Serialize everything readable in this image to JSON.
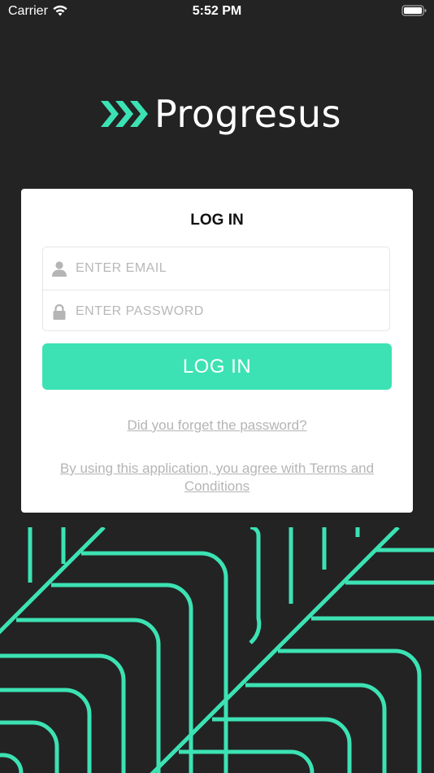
{
  "status_bar": {
    "carrier": "Carrier",
    "time": "5:52 PM"
  },
  "logo": {
    "name": "Progresus",
    "icon": "chevrons-right-icon",
    "accent_color": "#3ce2b3"
  },
  "login_card": {
    "title": "LOG IN",
    "email_placeholder": "ENTER EMAIL",
    "password_placeholder": "ENTER PASSWORD",
    "email_icon": "user-icon",
    "password_icon": "lock-icon",
    "login_button": "LOG IN",
    "forgot_password": "Did you forget the password?",
    "terms": "By using this application, you agree with Terms and Conditions"
  },
  "colors": {
    "background": "#232323",
    "accent": "#3ce2b3",
    "card": "#ffffff",
    "link": "#b5b5b5"
  }
}
